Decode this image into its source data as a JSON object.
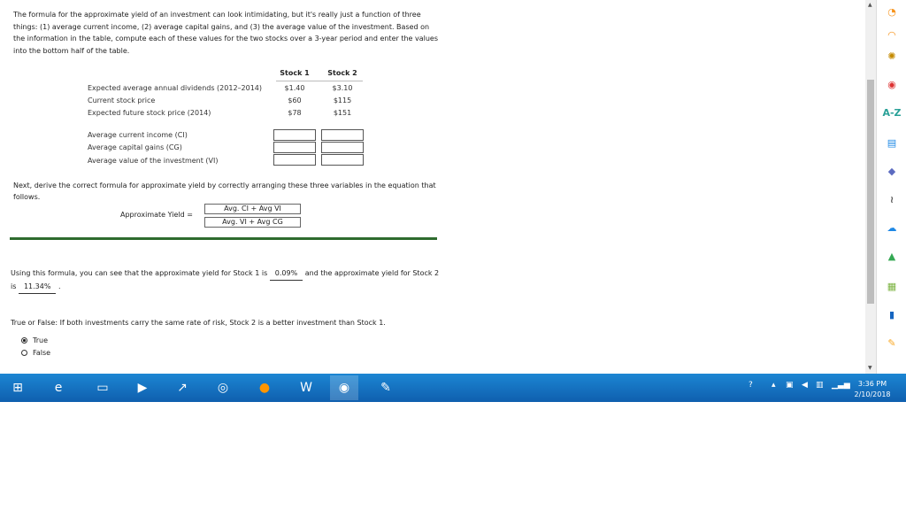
{
  "question": {
    "intro": "The formula for the approximate yield of an investment can look intimidating, but it's really just a function of three things: (1) average current income, (2) average capital gains, and (3) the average value of the investment. Based on the information in the table, compute each of these values for the two stocks over a 3-year period and enter the values into the bottom half of the table.",
    "col1": "Stock 1",
    "col2": "Stock 2",
    "rows": [
      {
        "label": "Expected average annual dividends (2012–2014)",
        "s1": "$1.40",
        "s2": "$3.10"
      },
      {
        "label": "Current stock price",
        "s1": "$60",
        "s2": "$115"
      },
      {
        "label": "Expected future stock price (2014)",
        "s1": "$78",
        "s2": "$151"
      }
    ],
    "input_rows": [
      {
        "label": "Average current income (CI)"
      },
      {
        "label": "Average capital gains (CG)"
      },
      {
        "label": "Average value of the investment (VI)"
      }
    ],
    "next": "Next, derive the correct formula for approximate yield by correctly arranging these three variables in the equation that follows.",
    "eq_label": "Approximate Yield  =",
    "numerator": "Avg. CI + Avg VI",
    "denominator": "Avg. VI + Avg CG",
    "using_pre": "Using this formula, you can see that the approximate yield for Stock 1 is",
    "answer1": "0.09%",
    "using_mid": "and the approximate yield for Stock 2 is",
    "answer2": "11.34%",
    "using_end": ".",
    "tf_question": "True or False: If both investments carry the same rate of risk, Stock 2 is a better investment than Stock 1.",
    "options": [
      "True",
      "False"
    ],
    "selected": "True"
  },
  "sidebar": {
    "items": [
      "rss-icon",
      "settings-icon",
      "news-icon",
      "A-Z",
      "document-icon",
      "pen-icon",
      "signal-icon",
      "cloud-icon",
      "drive-icon",
      "cart-icon",
      "tablet-icon",
      "pencil-icon"
    ]
  },
  "taskbar": {
    "apps": [
      "start-icon",
      "ie-icon",
      "folder-icon",
      "media-icon",
      "chart-app-icon",
      "wifi-app-icon",
      "firefox-icon",
      "word-icon",
      "chrome-icon",
      "paint-icon"
    ],
    "time": "3:36 PM",
    "date": "2/10/2018"
  },
  "colors": {
    "taskbar": "#1c86d3",
    "divider": "#2e6b2e"
  }
}
